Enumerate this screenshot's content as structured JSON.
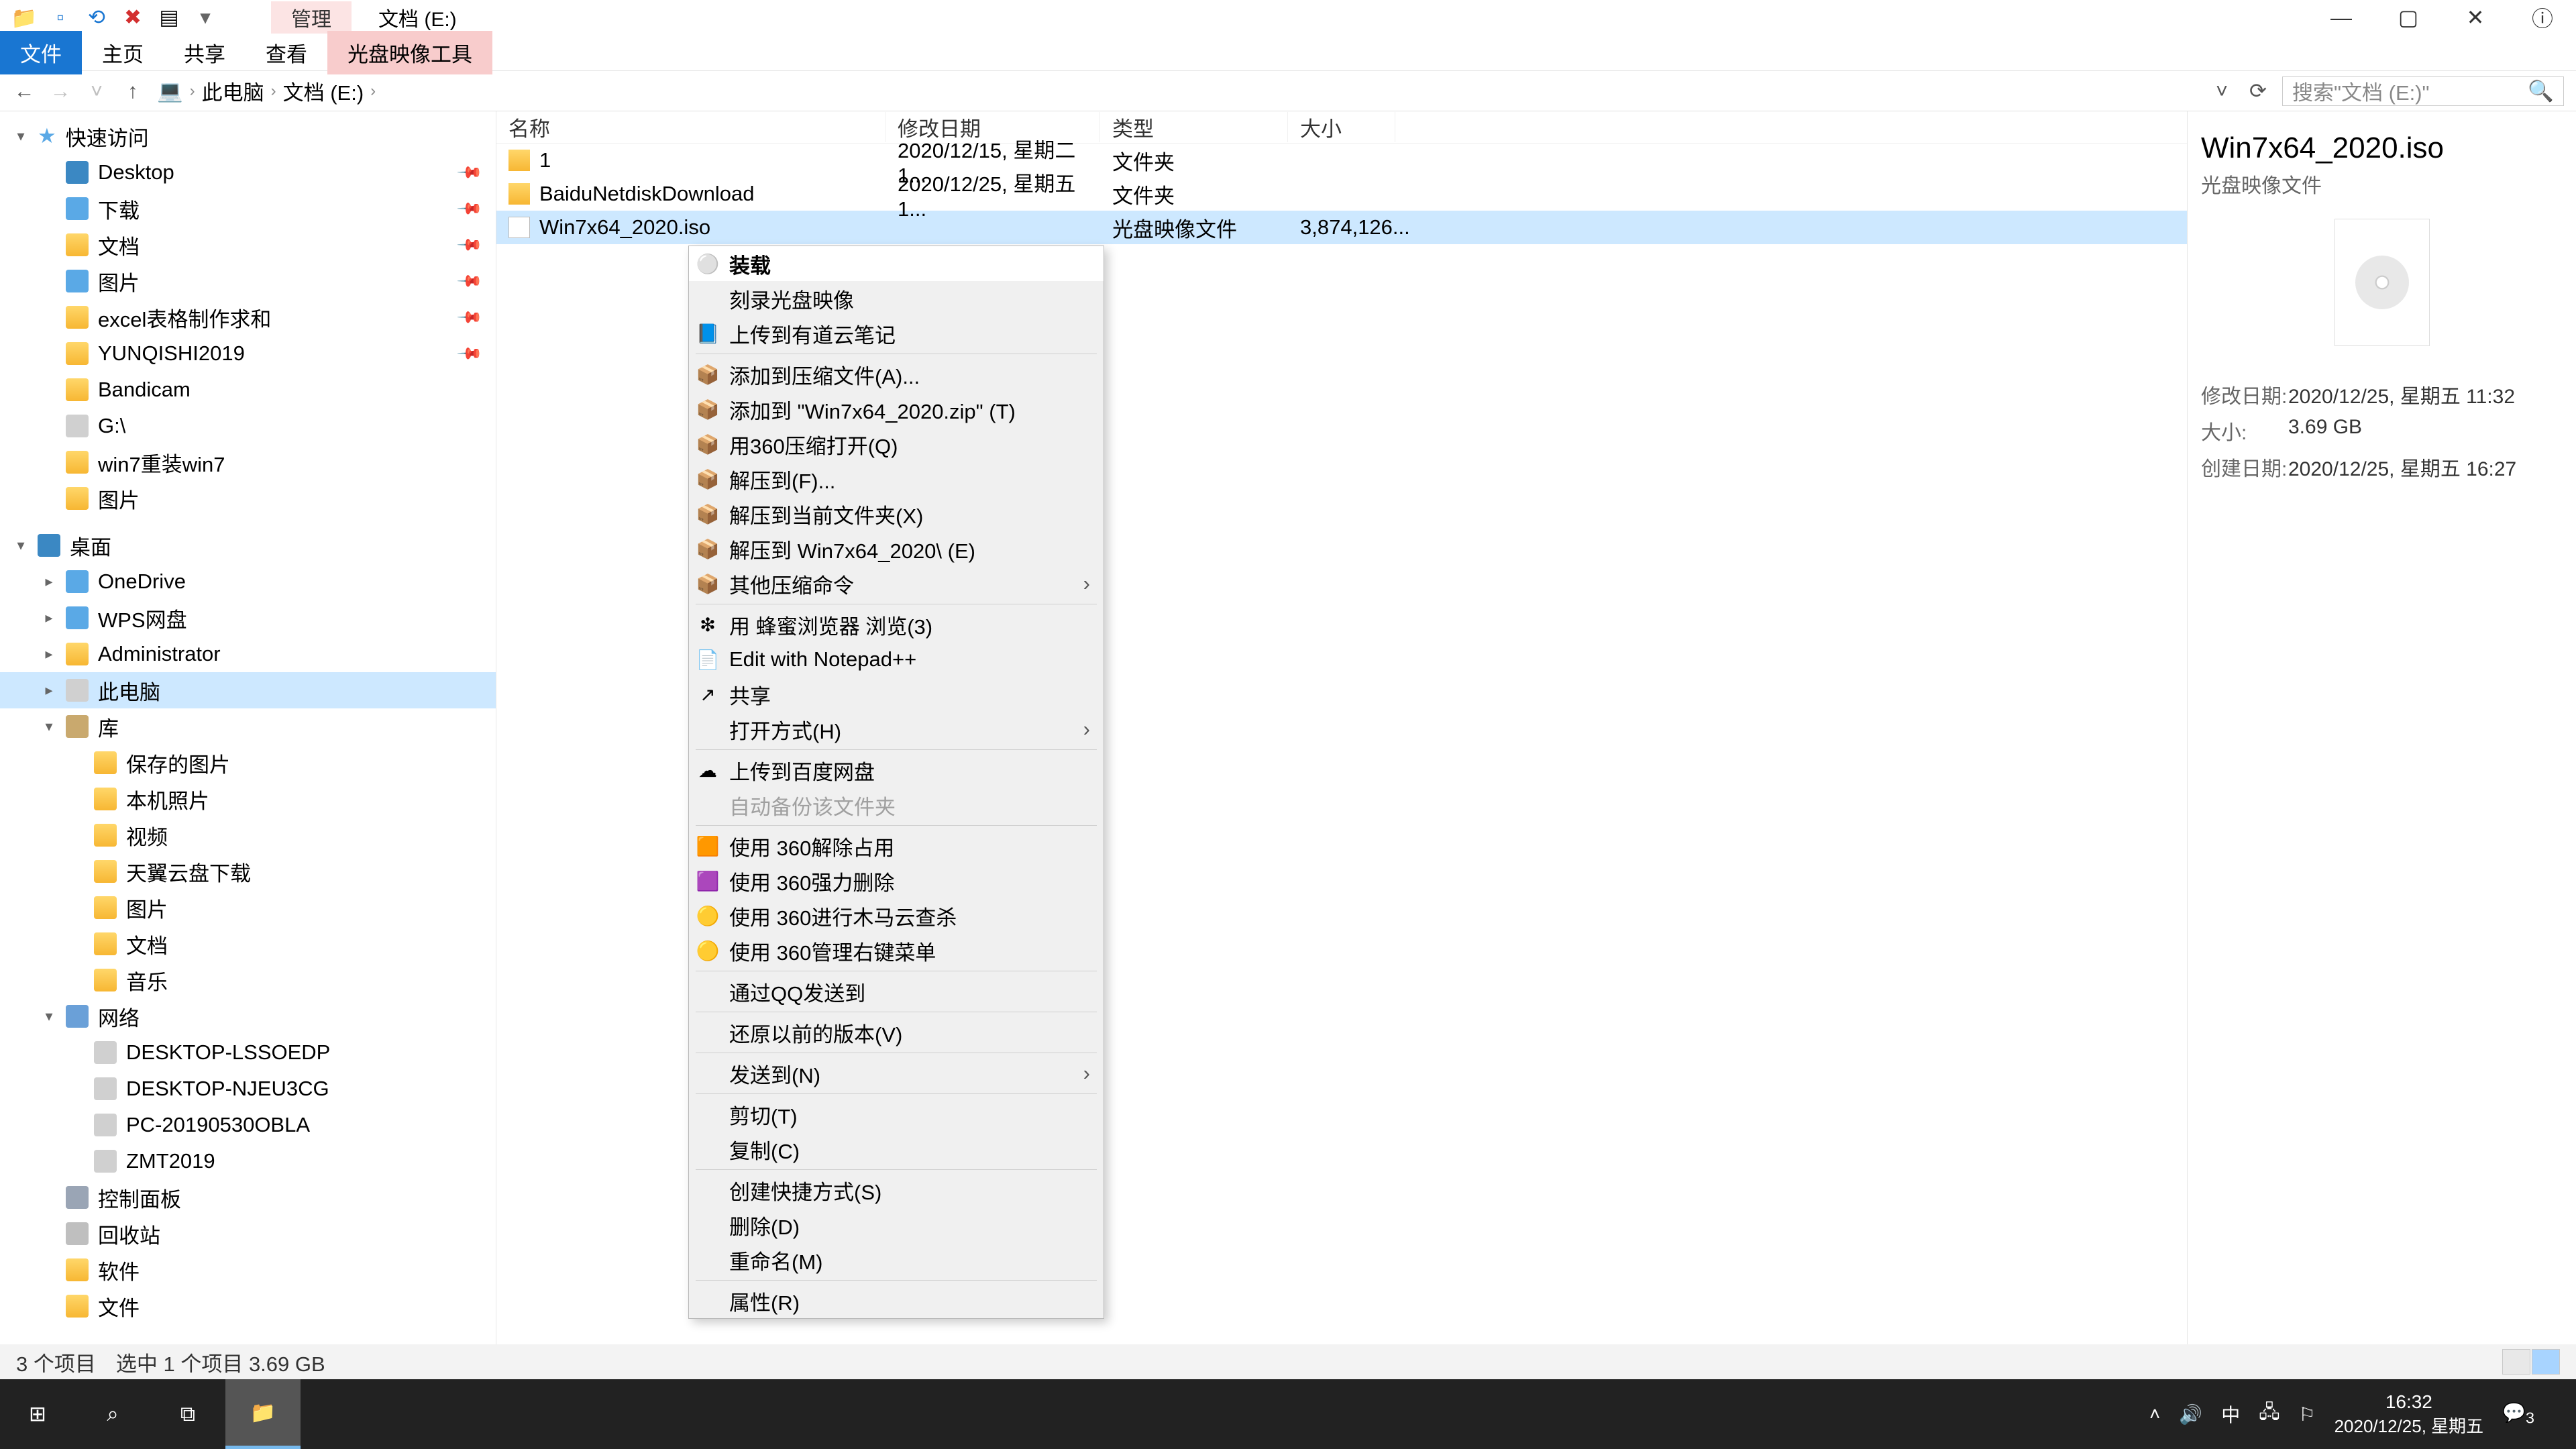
{
  "window": {
    "context_tab": "管理",
    "title": "文档 (E:)",
    "min": "—",
    "max": "▢",
    "close": "✕"
  },
  "ribbon": {
    "file": "文件",
    "home": "主页",
    "share": "共享",
    "view": "查看",
    "disc": "光盘映像工具"
  },
  "addr": {
    "root": "此电脑",
    "folder": "文档 (E:)",
    "search_placeholder": "搜索\"文档 (E:)\""
  },
  "tree": {
    "quick": "快速访问",
    "items_quick": [
      {
        "label": "Desktop",
        "icon": "desk",
        "pin": true
      },
      {
        "label": "下载",
        "icon": "blue",
        "pin": true
      },
      {
        "label": "文档",
        "icon": "folder",
        "pin": true
      },
      {
        "label": "图片",
        "icon": "blue",
        "pin": true
      },
      {
        "label": "excel表格制作求和",
        "icon": "folder",
        "pin": true
      },
      {
        "label": "YUNQISHI2019",
        "icon": "folder",
        "pin": true
      },
      {
        "label": "Bandicam",
        "icon": "folder"
      },
      {
        "label": "G:\\",
        "icon": "drive"
      },
      {
        "label": "win7重装win7",
        "icon": "folder"
      },
      {
        "label": "图片",
        "icon": "folder"
      }
    ],
    "desktop": "桌面",
    "items_desktop": [
      {
        "label": "OneDrive",
        "icon": "blue"
      },
      {
        "label": "WPS网盘",
        "icon": "blue"
      },
      {
        "label": "Administrator",
        "icon": "folder"
      },
      {
        "label": "此电脑",
        "icon": "drive",
        "sel": true
      },
      {
        "label": "库",
        "icon": "lib"
      }
    ],
    "items_lib": [
      {
        "label": "保存的图片",
        "icon": "folder"
      },
      {
        "label": "本机照片",
        "icon": "folder"
      },
      {
        "label": "视频",
        "icon": "folder"
      },
      {
        "label": "天翼云盘下载",
        "icon": "folder"
      },
      {
        "label": "图片",
        "icon": "folder"
      },
      {
        "label": "文档",
        "icon": "folder"
      },
      {
        "label": "音乐",
        "icon": "folder"
      }
    ],
    "network": "网络",
    "items_net": [
      {
        "label": "DESKTOP-LSSOEDP",
        "icon": "drive"
      },
      {
        "label": "DESKTOP-NJEU3CG",
        "icon": "drive"
      },
      {
        "label": "PC-20190530OBLA",
        "icon": "drive"
      },
      {
        "label": "ZMT2019",
        "icon": "drive"
      }
    ],
    "items_tail": [
      {
        "label": "控制面板",
        "icon": "ctl"
      },
      {
        "label": "回收站",
        "icon": "bin"
      },
      {
        "label": "软件",
        "icon": "folder"
      },
      {
        "label": "文件",
        "icon": "folder"
      }
    ]
  },
  "cols": {
    "name": "名称",
    "date": "修改日期",
    "type": "类型",
    "size": "大小"
  },
  "col_w": {
    "name": 580,
    "date": 320,
    "type": 280,
    "size": 160
  },
  "rows": [
    {
      "name": "1",
      "date": "2020/12/15, 星期二 1...",
      "type": "文件夹",
      "size": "",
      "kind": "folder"
    },
    {
      "name": "BaiduNetdiskDownload",
      "date": "2020/12/25, 星期五 1...",
      "type": "文件夹",
      "size": "",
      "kind": "folder"
    },
    {
      "name": "Win7x64_2020.iso",
      "date": "",
      "type": "光盘映像文件",
      "size": "3,874,126...",
      "kind": "file",
      "sel": true
    }
  ],
  "preview": {
    "title": "Win7x64_2020.iso",
    "sub": "光盘映像文件",
    "meta": [
      {
        "k": "修改日期:",
        "v": "2020/12/25, 星期五 11:32"
      },
      {
        "k": "大小:",
        "v": "3.69 GB"
      },
      {
        "k": "创建日期:",
        "v": "2020/12/25, 星期五 16:27"
      }
    ]
  },
  "status": {
    "a": "3 个项目",
    "b": "选中 1 个项目  3.69 GB"
  },
  "ctx": {
    "items": [
      {
        "label": "装载",
        "ico": "⚪",
        "sel": true
      },
      {
        "label": "刻录光盘映像",
        "ico": ""
      },
      {
        "label": "上传到有道云笔记",
        "ico": "📘"
      },
      {
        "sep": true
      },
      {
        "label": "添加到压缩文件(A)...",
        "ico": "📦"
      },
      {
        "label": "添加到 \"Win7x64_2020.zip\" (T)",
        "ico": "📦"
      },
      {
        "label": "用360压缩打开(Q)",
        "ico": "📦"
      },
      {
        "label": "解压到(F)...",
        "ico": "📦"
      },
      {
        "label": "解压到当前文件夹(X)",
        "ico": "📦"
      },
      {
        "label": "解压到 Win7x64_2020\\ (E)",
        "ico": "📦"
      },
      {
        "label": "其他压缩命令",
        "ico": "📦",
        "sub": true
      },
      {
        "sep": true
      },
      {
        "label": "用 蜂蜜浏览器 浏览(3)",
        "ico": "❇"
      },
      {
        "label": "Edit with Notepad++",
        "ico": "📄"
      },
      {
        "label": "共享",
        "ico": "↗"
      },
      {
        "label": "打开方式(H)",
        "ico": "",
        "sub": true
      },
      {
        "sep": true
      },
      {
        "label": "上传到百度网盘",
        "ico": "☁"
      },
      {
        "label": "自动备份该文件夹",
        "ico": "",
        "disabled": true
      },
      {
        "sep": true
      },
      {
        "label": "使用 360解除占用",
        "ico": "🟧"
      },
      {
        "label": "使用 360强力删除",
        "ico": "🟪"
      },
      {
        "label": "使用 360进行木马云查杀",
        "ico": "🟡"
      },
      {
        "label": "使用 360管理右键菜单",
        "ico": "🟡"
      },
      {
        "sep": true
      },
      {
        "label": "通过QQ发送到",
        "ico": ""
      },
      {
        "sep": true
      },
      {
        "label": "还原以前的版本(V)",
        "ico": ""
      },
      {
        "sep": true
      },
      {
        "label": "发送到(N)",
        "ico": "",
        "sub": true
      },
      {
        "sep": true
      },
      {
        "label": "剪切(T)",
        "ico": ""
      },
      {
        "label": "复制(C)",
        "ico": ""
      },
      {
        "sep": true
      },
      {
        "label": "创建快捷方式(S)",
        "ico": ""
      },
      {
        "label": "删除(D)",
        "ico": ""
      },
      {
        "label": "重命名(M)",
        "ico": ""
      },
      {
        "sep": true
      },
      {
        "label": "属性(R)",
        "ico": ""
      }
    ]
  },
  "taskbar": {
    "time": "16:32",
    "date": "2020/12/25, 星期五",
    "ime": "中",
    "notif": "3"
  }
}
